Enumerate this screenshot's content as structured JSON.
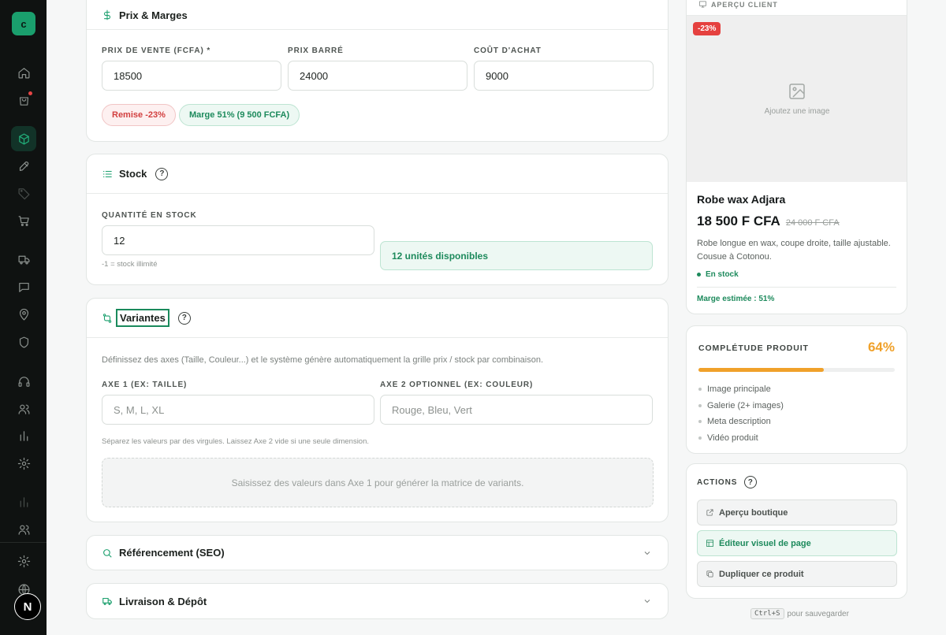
{
  "sidebar": {
    "logo_letter": "c",
    "icons": [
      "home-icon",
      "shopping-bag-icon",
      "box-icon",
      "rocket-icon",
      "tag-icon",
      "cart-icon",
      "truck-icon",
      "message-icon",
      "map-pin-icon",
      "shield-icon",
      "headphones-icon",
      "users-icon",
      "bar-chart-icon",
      "settings-icon",
      "bar-chart-icon",
      "users-icon",
      "settings-icon",
      "globe-icon"
    ],
    "avatar_letter": "N"
  },
  "pricing": {
    "title": "Prix & Marges",
    "sale_price_label": "PRIX DE VENTE (FCFA) *",
    "sale_price_value": "18500",
    "strike_price_label": "PRIX BARRÉ",
    "strike_price_value": "24000",
    "cost_label": "COÛT D'ACHAT",
    "cost_value": "9000",
    "discount_pill": "Remise -23%",
    "margin_pill": "Marge 51% (9 500 FCFA)"
  },
  "stock": {
    "title": "Stock",
    "qty_label": "QUANTITÉ EN STOCK",
    "qty_value": "12",
    "qty_hint": "-1 = stock illimité",
    "available_text": "12 unités disponibles"
  },
  "variants": {
    "title": "Variantes",
    "description": "Définissez des axes (Taille, Couleur...) et le système génère automatiquement la grille prix / stock par combinaison.",
    "axis1_label": "AXE 1 (EX: TAILLE)",
    "axis1_placeholder": "S, M, L, XL",
    "axis2_label": "AXE 2 OPTIONNEL (EX: COULEUR)",
    "axis2_placeholder": "Rouge, Bleu, Vert",
    "hint": "Séparez les valeurs par des virgules. Laissez Axe 2 vide si une seule dimension.",
    "empty_text": "Saisissez des valeurs dans Axe 1 pour générer la matrice de variants."
  },
  "seo": {
    "title": "Référencement (SEO)"
  },
  "shipping": {
    "title": "Livraison & Dépôt"
  },
  "preview": {
    "label": "APERÇU CLIENT",
    "discount_badge": "-23%",
    "image_placeholder": "Ajoutez une image",
    "product_name": "Robe wax Adjara",
    "price": "18 500 F CFA",
    "old_price": "24 000 F CFA",
    "description": "Robe longue en wax, coupe droite, taille ajustable. Cousue à Cotonou.",
    "stock_status": "En stock",
    "estimated_margin": "Marge estimée : 51%"
  },
  "completeness": {
    "title": "COMPLÉTUDE PRODUIT",
    "percent_label": "64%",
    "percent": 0.64,
    "items": [
      "Image principale",
      "Galerie (2+ images)",
      "Meta description",
      "Vidéo produit"
    ]
  },
  "actions": {
    "title": "ACTIONS",
    "buttons": [
      "Aperçu boutique",
      "Éditeur visuel de page",
      "Dupliquer ce produit"
    ]
  },
  "save_hint": {
    "key": "Ctrl+S",
    "text": "pour sauvegarder"
  },
  "colors": {
    "accent": "#1a9f6d",
    "warning": "#f0a12a",
    "danger": "#e5413f",
    "sidebar": "#0f1211"
  }
}
